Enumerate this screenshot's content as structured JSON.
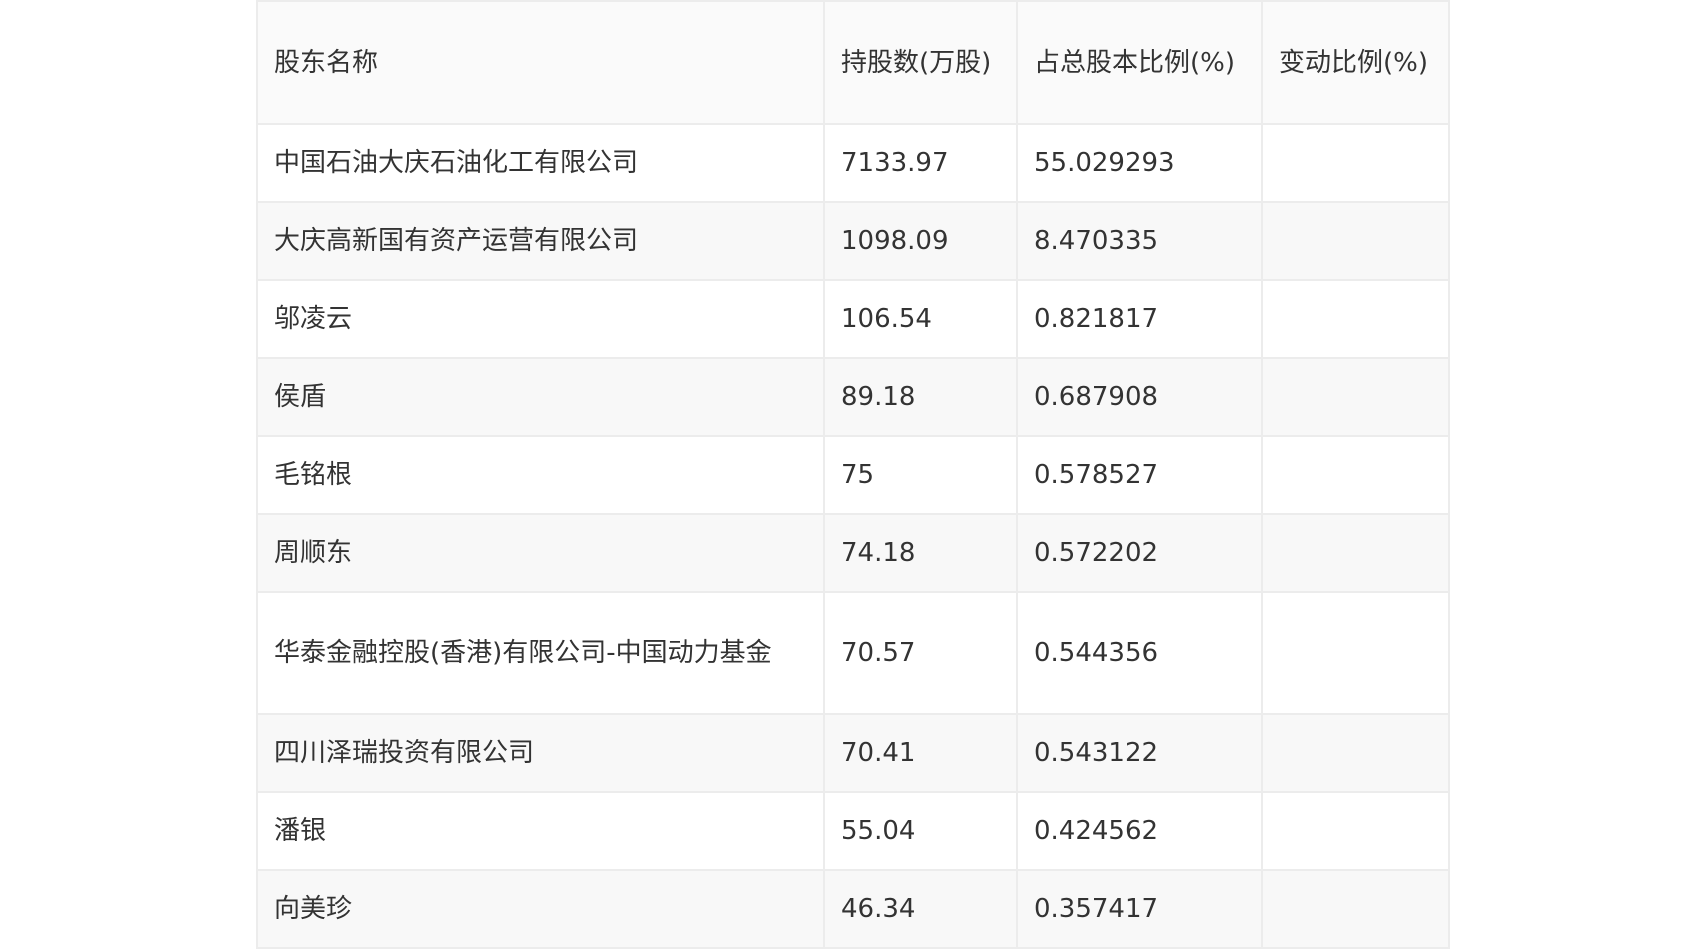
{
  "table": {
    "headers": [
      "股东名称",
      "持股数(万股)",
      "占总股本比例(%)",
      "变动比例(%)"
    ],
    "rows": [
      [
        "中国石油大庆石油化工有限公司",
        "7133.97",
        "55.029293",
        ""
      ],
      [
        "大庆高新国有资产运营有限公司",
        "1098.09",
        "8.470335",
        ""
      ],
      [
        "邬凌云",
        "106.54",
        "0.821817",
        ""
      ],
      [
        "侯盾",
        "89.18",
        "0.687908",
        ""
      ],
      [
        "毛铭根",
        "75",
        "0.578527",
        ""
      ],
      [
        "周顺东",
        "74.18",
        "0.572202",
        ""
      ],
      [
        "华泰金融控股(香港)有限公司-中国动力基金",
        "70.57",
        "0.544356",
        ""
      ],
      [
        "四川泽瑞投资有限公司",
        "70.41",
        "0.543122",
        ""
      ],
      [
        "潘银",
        "55.04",
        "0.424562",
        ""
      ],
      [
        "向美珍",
        "46.34",
        "0.357417",
        ""
      ]
    ]
  }
}
